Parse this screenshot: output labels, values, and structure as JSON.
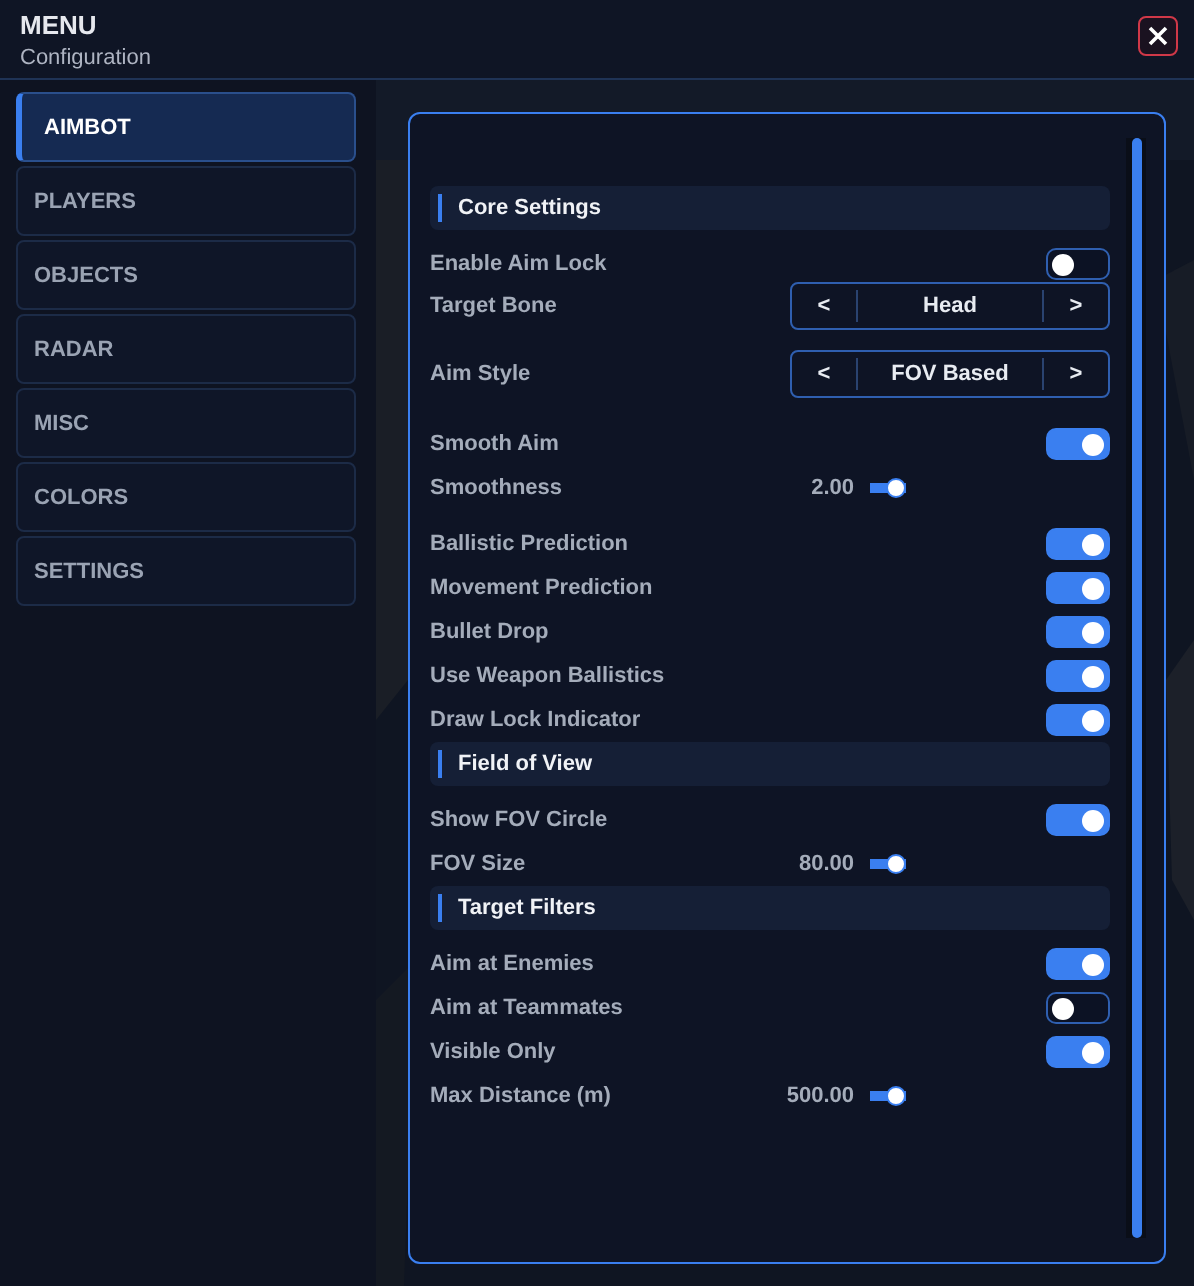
{
  "window": {
    "title": "MENU",
    "subtitle": "Configuration"
  },
  "sidebar": {
    "items": [
      {
        "label": "AIMBOT",
        "selected": true
      },
      {
        "label": "PLAYERS",
        "selected": false
      },
      {
        "label": "OBJECTS",
        "selected": false
      },
      {
        "label": "RADAR",
        "selected": false
      },
      {
        "label": "MISC",
        "selected": false
      },
      {
        "label": "COLORS",
        "selected": false
      },
      {
        "label": "SETTINGS",
        "selected": false
      }
    ]
  },
  "sections": [
    {
      "title": "Core Settings",
      "rows": [
        {
          "kind": "toggle",
          "label": "Enable Aim Lock",
          "on": false
        },
        {
          "kind": "selector",
          "label": "Target Bone",
          "value": "Head",
          "prev": "<",
          "next": ">"
        },
        {
          "kind": "selector",
          "label": "Aim Style",
          "value": "FOV Based",
          "prev": "<",
          "next": ">"
        },
        {
          "kind": "toggle",
          "label": "Smooth Aim",
          "on": true
        },
        {
          "kind": "slider",
          "label": "Smoothness",
          "reading": "2.00"
        },
        {
          "kind": "toggle",
          "label": "Ballistic Prediction",
          "on": true
        },
        {
          "kind": "toggle",
          "label": "Movement Prediction",
          "on": true
        },
        {
          "kind": "toggle",
          "label": "Bullet Drop",
          "on": true
        },
        {
          "kind": "toggle",
          "label": "Use Weapon Ballistics",
          "on": true
        },
        {
          "kind": "toggle",
          "label": "Draw Lock Indicator",
          "on": true
        }
      ]
    },
    {
      "title": "Field of View",
      "rows": [
        {
          "kind": "toggle",
          "label": "Show FOV Circle",
          "on": true
        },
        {
          "kind": "slider",
          "label": "FOV Size",
          "reading": "80.00"
        }
      ]
    },
    {
      "title": "Target Filters",
      "rows": [
        {
          "kind": "toggle",
          "label": "Aim at Enemies",
          "on": true
        },
        {
          "kind": "toggle",
          "label": "Aim at Teammates",
          "on": false
        },
        {
          "kind": "toggle",
          "label": "Visible Only",
          "on": true
        },
        {
          "kind": "slider",
          "label": "Max Distance (m)",
          "reading": "500.00"
        }
      ]
    }
  ]
}
